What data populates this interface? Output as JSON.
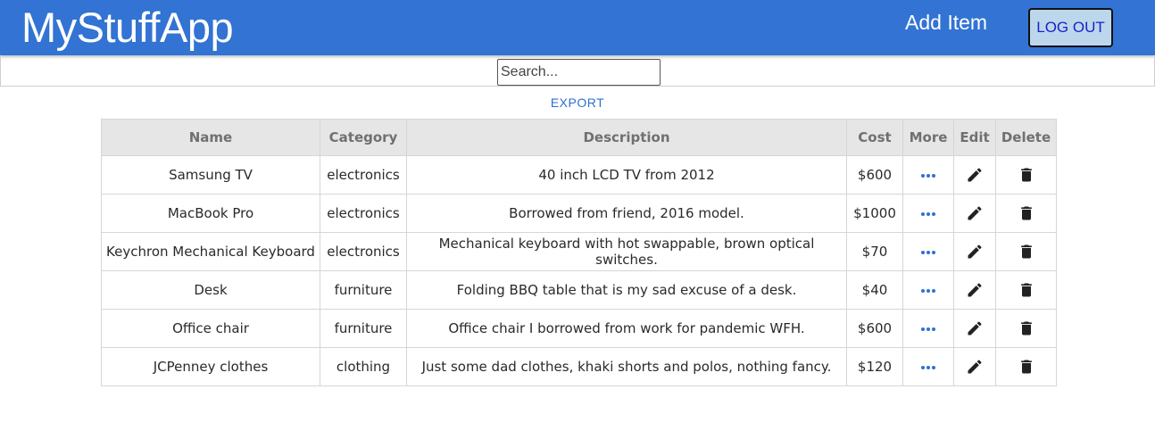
{
  "header": {
    "title": "MyStuffApp",
    "add_item": "Add Item",
    "logout": "LOG OUT"
  },
  "search": {
    "placeholder": "Search...",
    "value": ""
  },
  "export_label": "EXPORT",
  "colors": {
    "header_bg": "#3273d4",
    "accent": "#2f6fd6",
    "logout_bg": "#bcd7ec"
  },
  "table": {
    "columns": [
      "Name",
      "Category",
      "Description",
      "Cost",
      "More",
      "Edit",
      "Delete"
    ],
    "rows": [
      {
        "name": "Samsung TV",
        "category": "electronics",
        "description": "40 inch LCD TV from 2012",
        "cost": "$600"
      },
      {
        "name": "MacBook Pro",
        "category": "electronics",
        "description": "Borrowed from friend, 2016 model.",
        "cost": "$1000"
      },
      {
        "name": "Keychron Mechanical Keyboard",
        "category": "electronics",
        "description": "Mechanical keyboard with hot swappable, brown optical switches.",
        "cost": "$70"
      },
      {
        "name": "Desk",
        "category": "furniture",
        "description": "Folding BBQ table that is my sad excuse of a desk.",
        "cost": "$40"
      },
      {
        "name": "Office chair",
        "category": "furniture",
        "description": "Office chair I borrowed from work for pandemic WFH.",
        "cost": "$600"
      },
      {
        "name": "JCPenney clothes",
        "category": "clothing",
        "description": "Just some dad clothes, khaki shorts and polos, nothing fancy.",
        "cost": "$120"
      }
    ],
    "row_icons": {
      "more": "more-horizontal-icon",
      "edit": "pencil-icon",
      "delete": "trash-icon"
    }
  }
}
